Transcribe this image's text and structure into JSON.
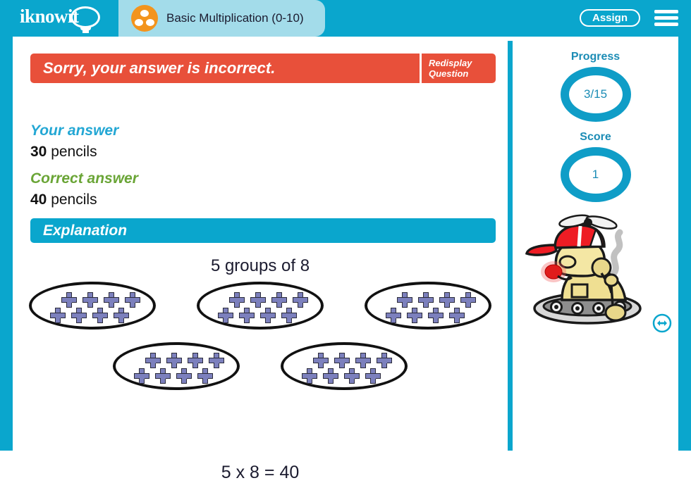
{
  "header": {
    "logo_text": "iknowit",
    "logo_icon": "lightbulb-icon",
    "title": "Basic Multiplication  (0-10)",
    "title_icon": "three-dots-circle-icon",
    "assign_label": "Assign",
    "menu_icon": "hamburger-menu-icon",
    "brand_color": "#0aa6cd",
    "title_pill_color": "#a3dcea",
    "title_icon_color": "#f3941d"
  },
  "feedback": {
    "message": "Sorry, your answer is incorrect.",
    "banner_color": "#e8503a",
    "redisplay_line1": "Redisplay",
    "redisplay_line2": "Question"
  },
  "answers": {
    "your_answer_label": "Your answer",
    "your_answer_number": "30",
    "your_answer_unit": "pencils",
    "your_answer_color": "#23a7d4",
    "correct_answer_label": "Correct answer",
    "correct_answer_number": "40",
    "correct_answer_unit": "pencils",
    "correct_answer_color": "#6aa536"
  },
  "explanation": {
    "heading": "Explanation",
    "heading_color": "#0aa6cd",
    "caption": "5 groups of 8",
    "equation": "5 x 8 = 40",
    "group_count": 5,
    "items_per_group": 8,
    "item_icon": "plus-sign-icon",
    "item_color": "#7c80bd"
  },
  "sidebar": {
    "progress_label": "Progress",
    "progress_value": "3/15",
    "score_label": "Score",
    "score_value": "1",
    "ring_color": "#0f9dc7",
    "label_color": "#1b8cb5",
    "mascot_icon": "robot-mascot-icon",
    "resize_icon": "left-right-arrow-icon"
  }
}
